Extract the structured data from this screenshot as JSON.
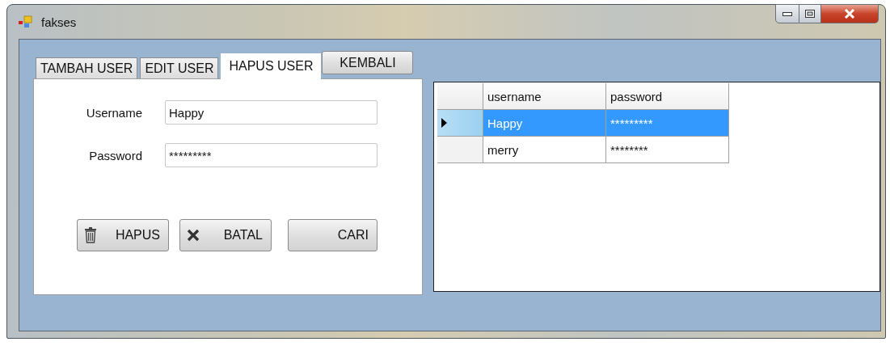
{
  "window": {
    "title": "fakses"
  },
  "tabs": [
    {
      "label": "TAMBAH USER",
      "selected": false
    },
    {
      "label": "EDIT USER",
      "selected": false
    },
    {
      "label": "HAPUS USER",
      "selected": true
    }
  ],
  "back_button": {
    "label": "KEMBALI"
  },
  "form": {
    "fields": [
      {
        "label": "Username",
        "value": "Happy"
      },
      {
        "label": "Password",
        "value": "*********"
      }
    ],
    "buttons": [
      {
        "label": "HAPUS",
        "kind": "trash"
      },
      {
        "label": "BATAL",
        "kind": "cross"
      },
      {
        "label": "CARI",
        "kind": "plain"
      }
    ]
  },
  "grid": {
    "columns": [
      "username",
      "password"
    ],
    "rows": [
      {
        "cells": [
          "Happy",
          "*********"
        ],
        "selected": true
      },
      {
        "cells": [
          "merry",
          "********"
        ],
        "selected": false
      }
    ]
  }
}
